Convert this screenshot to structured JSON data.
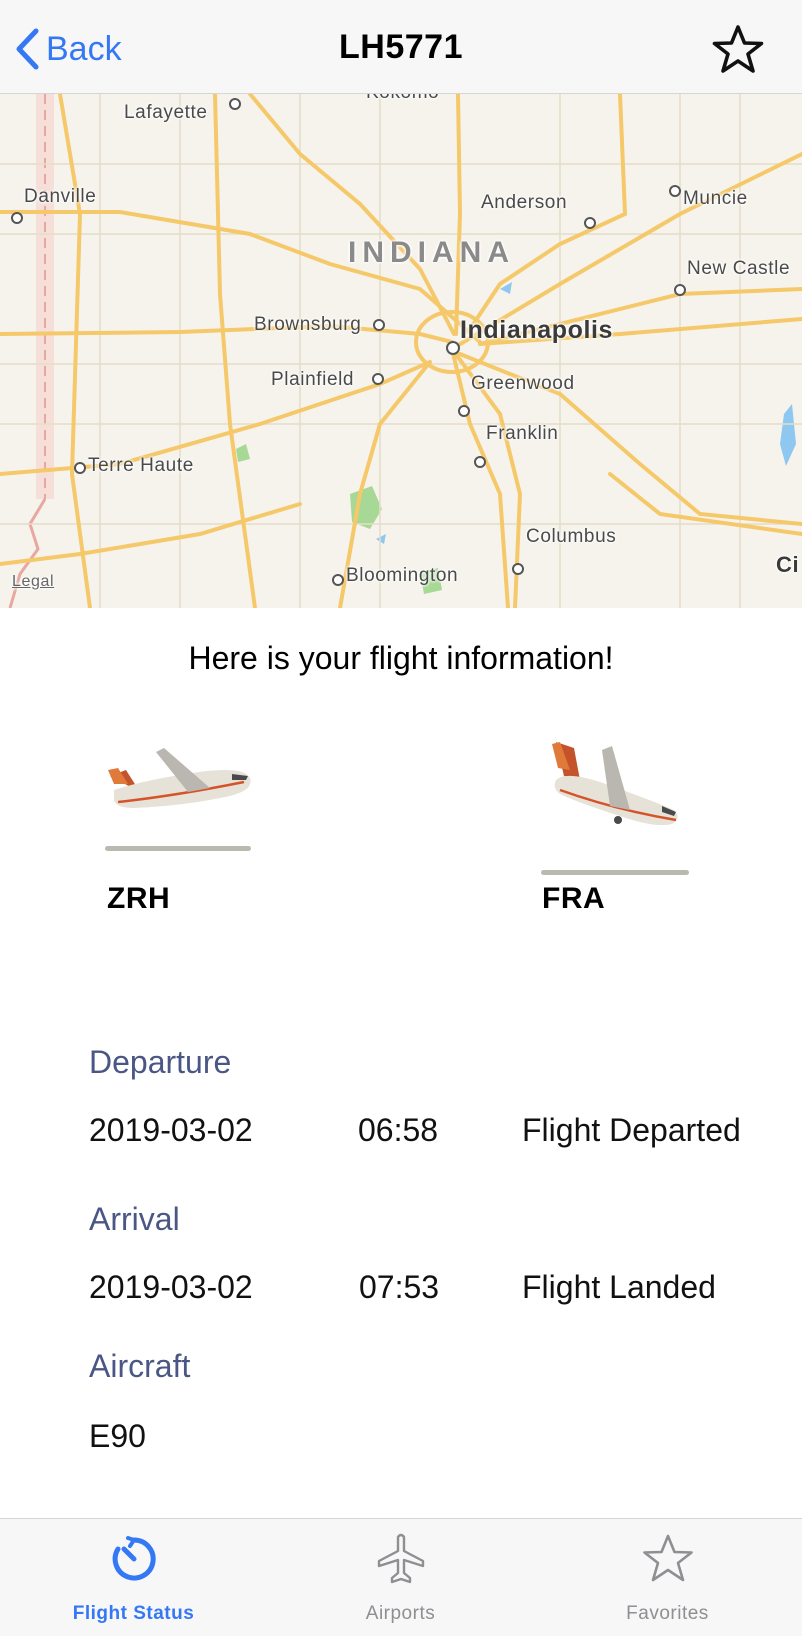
{
  "nav": {
    "back_label": "Back",
    "title": "LH5771",
    "favorite_icon": "star-outline-icon"
  },
  "map": {
    "state_label": "INDIANA",
    "legal": "Legal",
    "cities": [
      {
        "name": "Kokomo"
      },
      {
        "name": "Lafayette"
      },
      {
        "name": "Danville"
      },
      {
        "name": "Anderson"
      },
      {
        "name": "Muncie"
      },
      {
        "name": "New Castle"
      },
      {
        "name": "Brownsburg"
      },
      {
        "name": "Indianapolis"
      },
      {
        "name": "Plainfield"
      },
      {
        "name": "Greenwood"
      },
      {
        "name": "Franklin"
      },
      {
        "name": "Terre Haute"
      },
      {
        "name": "Columbus"
      },
      {
        "name": "Bloomington"
      },
      {
        "name": "Ci"
      }
    ],
    "colors": {
      "road": "#f5c86a",
      "land": "#f6f3ec",
      "park": "#a8d896",
      "water": "#8ec7ef",
      "border": "#f2c2bb"
    }
  },
  "info": {
    "title": "Here is your flight information!",
    "origin": "ZRH",
    "destination": "FRA",
    "departure": {
      "label": "Departure",
      "date": "2019-03-02",
      "time": "06:58",
      "status": "Flight Departed"
    },
    "arrival": {
      "label": "Arrival",
      "date": "2019-03-02",
      "time": "07:53",
      "status": "Flight Landed"
    },
    "aircraft": {
      "label": "Aircraft",
      "value": "E90"
    }
  },
  "tabs": [
    {
      "label": "Flight Status",
      "icon": "flight-status-icon",
      "active": true
    },
    {
      "label": "Airports",
      "icon": "airplane-icon",
      "active": false
    },
    {
      "label": "Favorites",
      "icon": "star-icon",
      "active": false
    }
  ],
  "colors": {
    "accent": "#3478f6",
    "section_label": "#4a5785",
    "inactive_tab": "#8e8e93"
  }
}
